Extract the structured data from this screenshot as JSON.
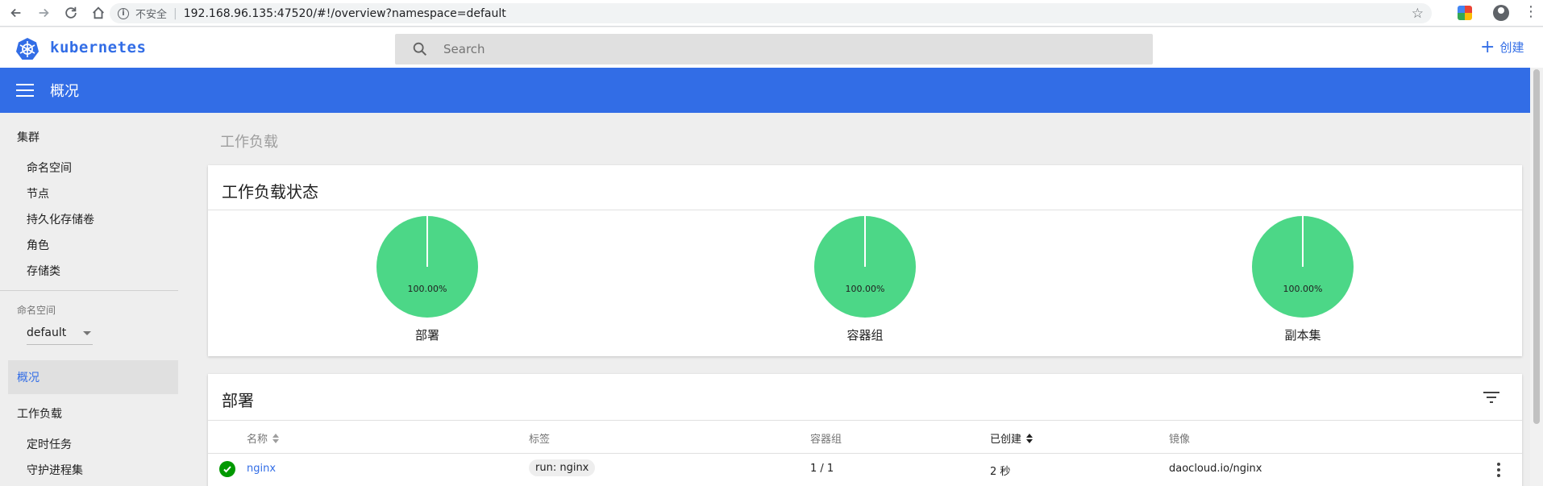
{
  "browser": {
    "insecure_label": "不安全",
    "separator": "|",
    "url": "192.168.96.135:47520/#!/overview?namespace=default"
  },
  "header": {
    "brand": "kubernetes",
    "search_placeholder": "Search",
    "create_label": "创建"
  },
  "toolbar": {
    "title": "概况"
  },
  "sidebar": {
    "cluster_section": "集群",
    "cluster_items": [
      "命名空间",
      "节点",
      "持久化存储卷",
      "角色",
      "存储类"
    ],
    "namespace_label": "命名空间",
    "namespace_value": "default",
    "active_item": "概况",
    "workload_section": "工作负载",
    "workload_items": [
      "定时任务",
      "守护进程集"
    ]
  },
  "main": {
    "heading": "工作负载",
    "status_card": {
      "title": "工作负载状态",
      "pies": [
        {
          "percent_label": "100.00%",
          "name": "部署",
          "value": 100
        },
        {
          "percent_label": "100.00%",
          "name": "容器组",
          "value": 100
        },
        {
          "percent_label": "100.00%",
          "name": "副本集",
          "value": 100
        }
      ]
    },
    "deploy_card": {
      "title": "部署",
      "columns": [
        "名称",
        "标签",
        "容器组",
        "已创建",
        "镜像"
      ],
      "rows": [
        {
          "name": "nginx",
          "label": "run: nginx",
          "pods": "1 / 1",
          "created": "2 秒",
          "image": "daocloud.io/nginx"
        }
      ]
    }
  },
  "colors": {
    "brand_blue": "#326de6",
    "pie_green": "#4cd787",
    "status_green": "#009900"
  }
}
